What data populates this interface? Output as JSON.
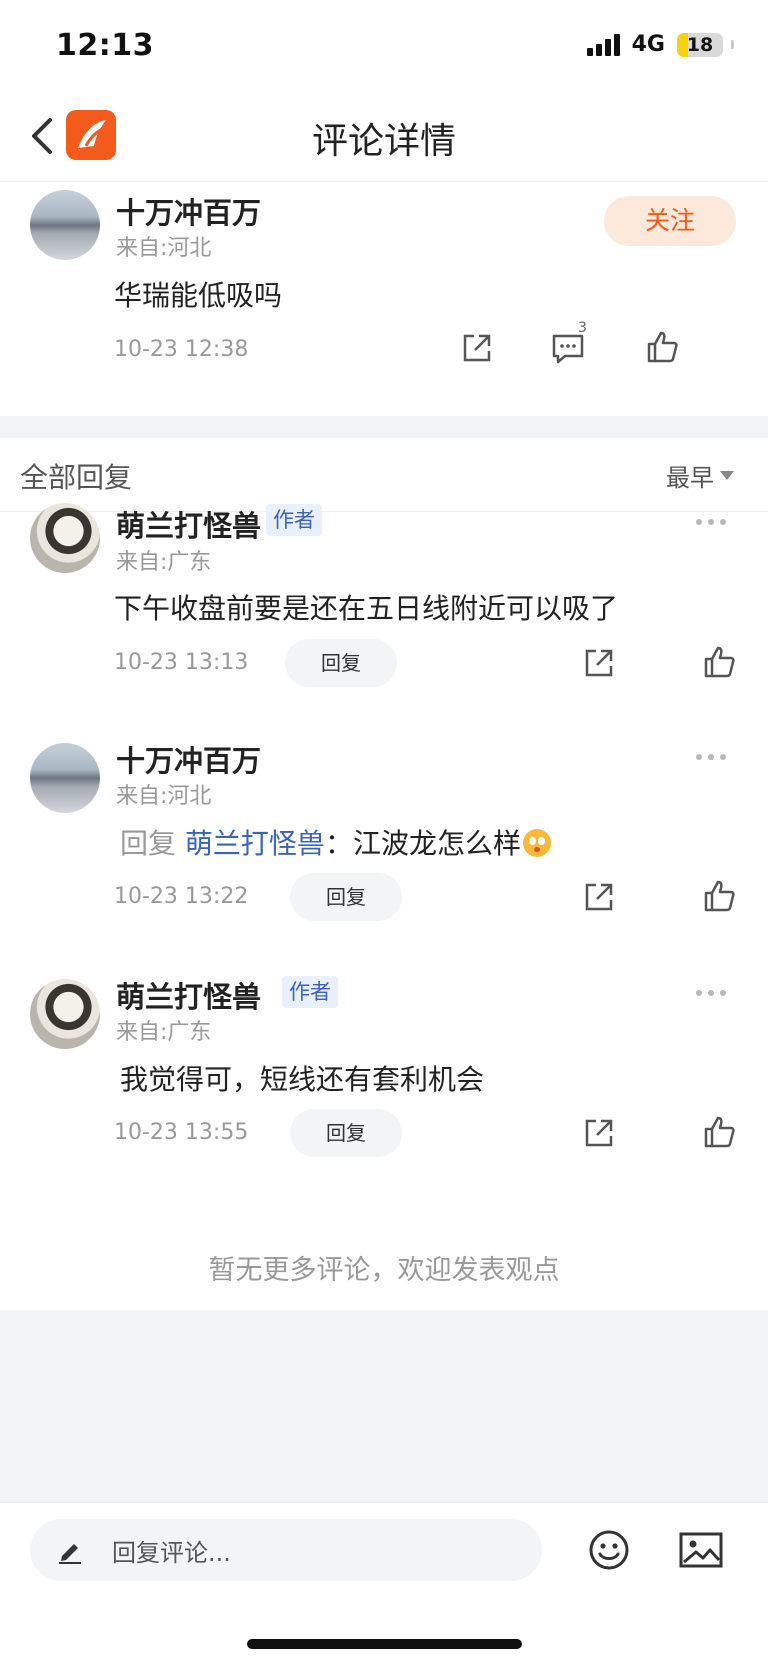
{
  "status_bar": {
    "time": "12:13",
    "network": "4G",
    "battery": "18"
  },
  "nav": {
    "title": "评论详情"
  },
  "main_comment": {
    "username": "十万冲百万",
    "location": "来自:河北",
    "text": "华瑞能低吸吗",
    "time": "10-23 12:38",
    "follow_label": "关注",
    "reply_count": "3"
  },
  "replies_section": {
    "title": "全部回复",
    "sort": "最早"
  },
  "replies": [
    {
      "username": "萌兰打怪兽",
      "tag": "作者",
      "location": "来自:广东",
      "text": "下午收盘前要是还在五日线附近可以吸了",
      "time": "10-23 13:13",
      "reply_label": "回复"
    },
    {
      "username": "十万冲百万",
      "location": "来自:河北",
      "reply_prefix": "回复",
      "mention": "萌兰打怪兽",
      "separator": "：",
      "text": "江波龙怎么样",
      "time": "10-23 13:22",
      "reply_label": "回复"
    },
    {
      "username": "萌兰打怪兽",
      "tag": "作者",
      "location": "来自:广东",
      "text": "我觉得可，短线还有套利机会",
      "time": "10-23 13:55",
      "reply_label": "回复"
    }
  ],
  "end_note": "暂无更多评论，欢迎发表观点",
  "bottom_bar": {
    "placeholder": "回复评论..."
  },
  "colors": {
    "accent": "#f35a1c",
    "mention": "#3b64b8",
    "follow_bg": "#fde8dc"
  }
}
